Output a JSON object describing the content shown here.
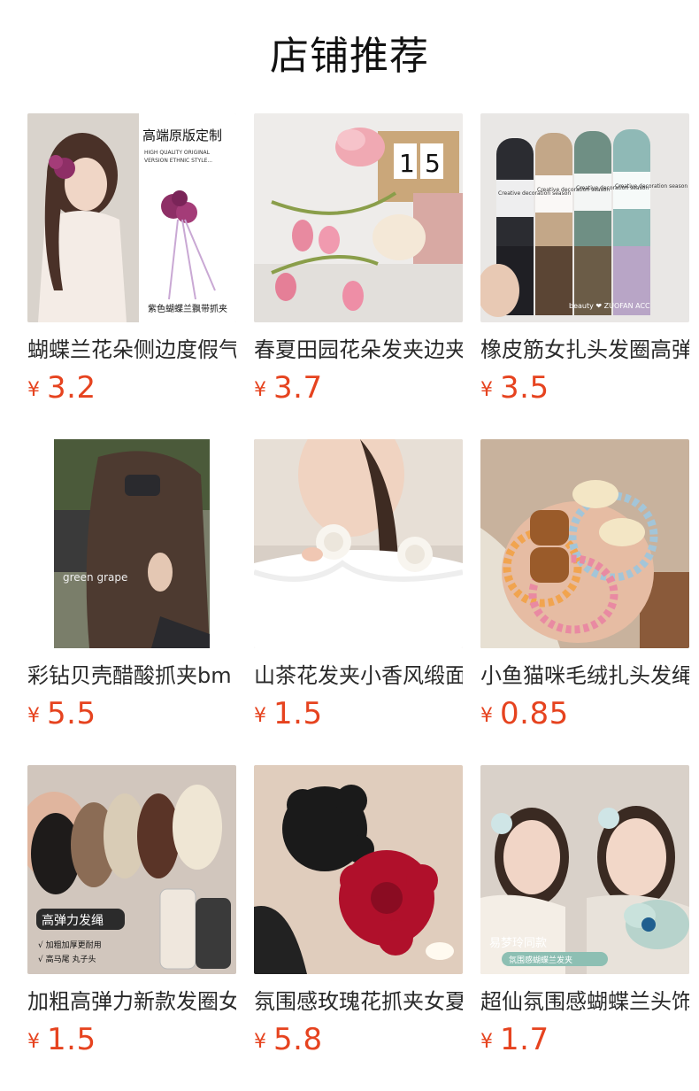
{
  "page": {
    "title": "店铺推荐"
  },
  "currency_symbol": "¥",
  "colors": {
    "price": "#e6431f",
    "text": "#2a2a2a"
  },
  "products": [
    {
      "name": "蝴蝶兰花朵侧边度假气质发夹",
      "price": "3.2",
      "image_texts": [
        "高端原版定制",
        "HIGH QUALITY ORIGINAL",
        "VERSION ETHNIC STYLE...",
        "紫色蝴蝶兰飘带抓夹"
      ]
    },
    {
      "name": "春夏田园花朵发夹边夹",
      "price": "3.7",
      "image_texts": [
        "1",
        "5"
      ]
    },
    {
      "name": "橡皮筋女扎头发圈高弹力",
      "price": "3.5",
      "image_texts": [
        "Creative decoration season",
        "Creative decoration season",
        "Creative decoration season",
        "Creative decoration season",
        "beauty ❤ ZUOFAN ACC"
      ]
    },
    {
      "name": "彩钻贝壳醋酸抓夹bm",
      "price": "5.5",
      "image_texts": [
        "green grape"
      ]
    },
    {
      "name": "山茶花发夹小香风缎面",
      "price": "1.5",
      "image_texts": []
    },
    {
      "name": "小鱼猫咪毛绒扎头发绳",
      "price": "0.85",
      "image_texts": []
    },
    {
      "name": "加粗高弹力新款发圈女",
      "price": "1.5",
      "image_texts": [
        "高弹力发绳",
        "√ 加粗加厚更耐用",
        "√ 高马尾 丸子头"
      ]
    },
    {
      "name": "氛围感玫瑰花抓夹女夏",
      "price": "5.8",
      "image_texts": []
    },
    {
      "name": "超仙氛围感蝴蝶兰头饰",
      "price": "1.7",
      "image_texts": [
        "易梦玲同款",
        "氛围感蝴蝶兰发夹"
      ]
    }
  ]
}
